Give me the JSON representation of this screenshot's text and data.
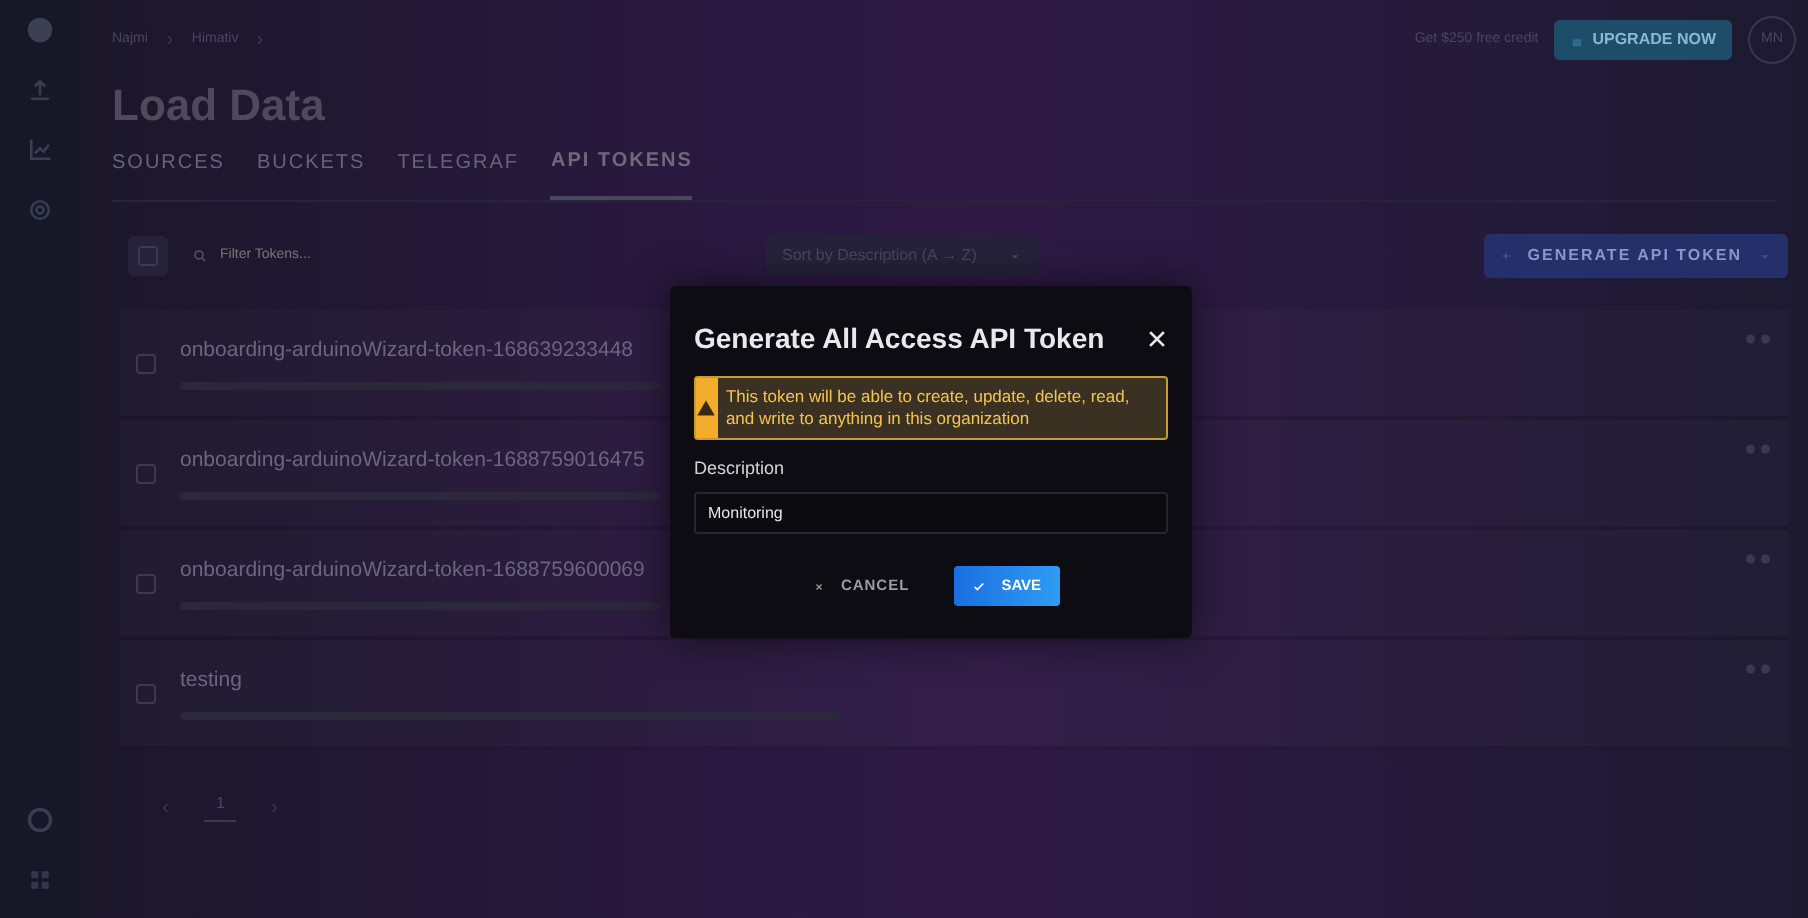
{
  "header": {
    "breadcrumbs": [
      "Najmi",
      "Himativ"
    ],
    "promo": "Get $250 free credit",
    "upgrade_button": "UPGRADE NOW",
    "avatar": "MN"
  },
  "page": {
    "title": "Load Data",
    "tabs": [
      {
        "label": "SOURCES",
        "selected": false
      },
      {
        "label": "BUCKETS",
        "selected": false
      },
      {
        "label": "TELEGRAF",
        "selected": false
      },
      {
        "label": "API TOKENS",
        "selected": true
      }
    ]
  },
  "toolbar": {
    "select_all": {
      "checked": false
    },
    "filter": {
      "placeholder": "Filter Tokens..."
    },
    "sort": "Sort by Description (A → Z)",
    "generate_button": "GENERATE API TOKEN"
  },
  "tokens": [
    {
      "name": "onboarding-arduinoWizard-token-168639233448",
      "checked": false
    },
    {
      "name": "onboarding-arduinoWizard-token-1688759016475",
      "checked": false
    },
    {
      "name": "onboarding-arduinoWizard-token-1688759600069",
      "checked": false
    },
    {
      "name": "testing",
      "checked": false
    }
  ],
  "pagination": {
    "page": "1"
  },
  "modal": {
    "title": "Generate All Access API Token",
    "warning": "This token will be able to create, update, delete, read, and write to anything in this organization",
    "description_label": "Description",
    "description_value": "Monitoring",
    "cancel_button": "CANCEL",
    "save_button": "SAVE"
  }
}
